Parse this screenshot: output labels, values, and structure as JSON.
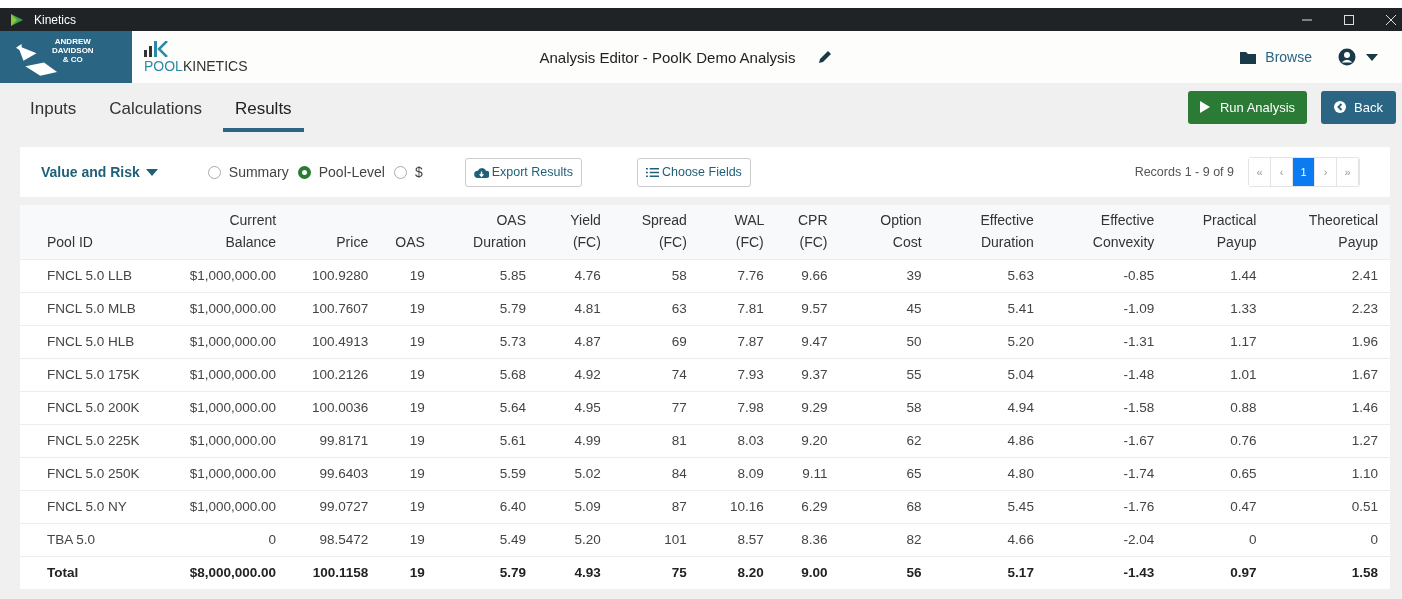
{
  "window": {
    "title": "Kinetics"
  },
  "header": {
    "company_logo": [
      "ANDREW",
      "DAVIDSON",
      "& CO"
    ],
    "product_logo": {
      "part_1": "POOL",
      "part_2": "KINETICS"
    },
    "title": "Analysis Editor - PoolK Demo Analysis",
    "browse": "Browse"
  },
  "tabs": [
    {
      "label": "Inputs",
      "selected": false
    },
    {
      "label": "Calculations",
      "selected": false
    },
    {
      "label": "Results",
      "selected": true
    }
  ],
  "actions": {
    "run": "Run Analysis",
    "back": "Back"
  },
  "toolbar": {
    "view": "Value and Risk",
    "radios": [
      {
        "label": "Summary",
        "selected": false
      },
      {
        "label": "Pool-Level",
        "selected": true
      },
      {
        "label": "$",
        "selected": false
      }
    ],
    "export": "Export Results",
    "choose": "Choose Fields",
    "records": "Records 1 - 9 of 9",
    "pager": [
      {
        "label": "«",
        "selected": false
      },
      {
        "label": "‹",
        "selected": false
      },
      {
        "label": "1",
        "selected": true
      },
      {
        "label": "›",
        "selected": false
      },
      {
        "label": "»",
        "selected": false
      }
    ]
  },
  "table": {
    "columns": [
      "Pool ID",
      "Current Balance",
      "Price",
      "OAS",
      "OAS Duration",
      "Yield (FC)",
      "Spread (FC)",
      "WAL (FC)",
      "CPR (FC)",
      "Option Cost",
      "Effective Duration",
      "Effective Convexity",
      "Practical Payup",
      "Theoretical Payup"
    ],
    "rows": [
      [
        "FNCL 5.0 LLB",
        "$1,000,000.00",
        "100.9280",
        "19",
        "5.85",
        "4.76",
        "58",
        "7.76",
        "9.66",
        "39",
        "5.63",
        "-0.85",
        "1.44",
        "2.41"
      ],
      [
        "FNCL 5.0 MLB",
        "$1,000,000.00",
        "100.7607",
        "19",
        "5.79",
        "4.81",
        "63",
        "7.81",
        "9.57",
        "45",
        "5.41",
        "-1.09",
        "1.33",
        "2.23"
      ],
      [
        "FNCL 5.0 HLB",
        "$1,000,000.00",
        "100.4913",
        "19",
        "5.73",
        "4.87",
        "69",
        "7.87",
        "9.47",
        "50",
        "5.20",
        "-1.31",
        "1.17",
        "1.96"
      ],
      [
        "FNCL 5.0 175K",
        "$1,000,000.00",
        "100.2126",
        "19",
        "5.68",
        "4.92",
        "74",
        "7.93",
        "9.37",
        "55",
        "5.04",
        "-1.48",
        "1.01",
        "1.67"
      ],
      [
        "FNCL 5.0 200K",
        "$1,000,000.00",
        "100.0036",
        "19",
        "5.64",
        "4.95",
        "77",
        "7.98",
        "9.29",
        "58",
        "4.94",
        "-1.58",
        "0.88",
        "1.46"
      ],
      [
        "FNCL 5.0 225K",
        "$1,000,000.00",
        "99.8171",
        "19",
        "5.61",
        "4.99",
        "81",
        "8.03",
        "9.20",
        "62",
        "4.86",
        "-1.67",
        "0.76",
        "1.27"
      ],
      [
        "FNCL 5.0 250K",
        "$1,000,000.00",
        "99.6403",
        "19",
        "5.59",
        "5.02",
        "84",
        "8.09",
        "9.11",
        "65",
        "4.80",
        "-1.74",
        "0.65",
        "1.10"
      ],
      [
        "FNCL 5.0 NY",
        "$1,000,000.00",
        "99.0727",
        "19",
        "6.40",
        "5.09",
        "87",
        "10.16",
        "6.29",
        "68",
        "5.45",
        "-1.76",
        "0.47",
        "0.51"
      ],
      [
        "TBA 5.0",
        "0",
        "98.5472",
        "19",
        "5.49",
        "5.20",
        "101",
        "8.57",
        "8.36",
        "82",
        "4.66",
        "-2.04",
        "0",
        "0"
      ]
    ],
    "total": [
      "Total",
      "$8,000,000.00",
      "100.1158",
      "19",
      "5.79",
      "4.93",
      "75",
      "8.20",
      "9.00",
      "56",
      "5.17",
      "-1.43",
      "0.97",
      "1.58"
    ]
  }
}
